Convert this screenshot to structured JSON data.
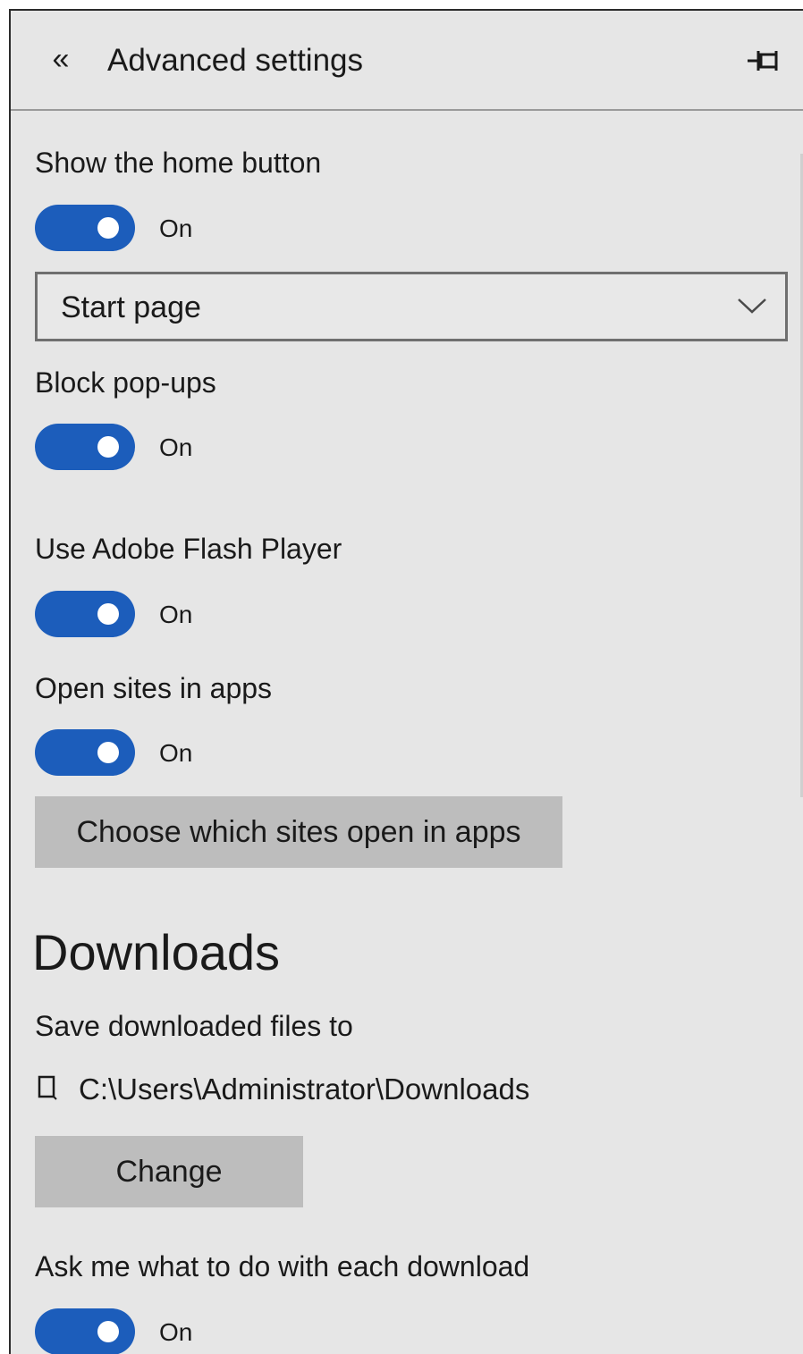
{
  "header": {
    "back_glyph": "«",
    "title": "Advanced settings",
    "back_icon": "double-chevron-left-icon",
    "pin_icon": "pin-icon"
  },
  "settings": {
    "home_button": {
      "label": "Show the home button",
      "state": "On",
      "on": true
    },
    "home_page_select": {
      "value": "Start page"
    },
    "popups": {
      "label": "Block pop-ups",
      "state": "On",
      "on": true
    },
    "flash": {
      "label": "Use Adobe Flash Player",
      "state": "On",
      "on": true
    },
    "open_sites": {
      "label": "Open sites in apps",
      "state": "On",
      "on": true
    },
    "choose_sites_button": "Choose which sites open in apps"
  },
  "downloads": {
    "title": "Downloads",
    "save_label": "Save downloaded files to",
    "path": "C:\\Users\\Administrator\\Downloads",
    "folder_icon": "folder-icon",
    "change_button": "Change",
    "ask": {
      "label": "Ask me what to do with each download",
      "state": "On",
      "on": true
    }
  },
  "colors": {
    "panel_bg": "#e6e6e6",
    "toggle_on": "#1c5dbb",
    "button_bg": "#bdbdbd"
  }
}
